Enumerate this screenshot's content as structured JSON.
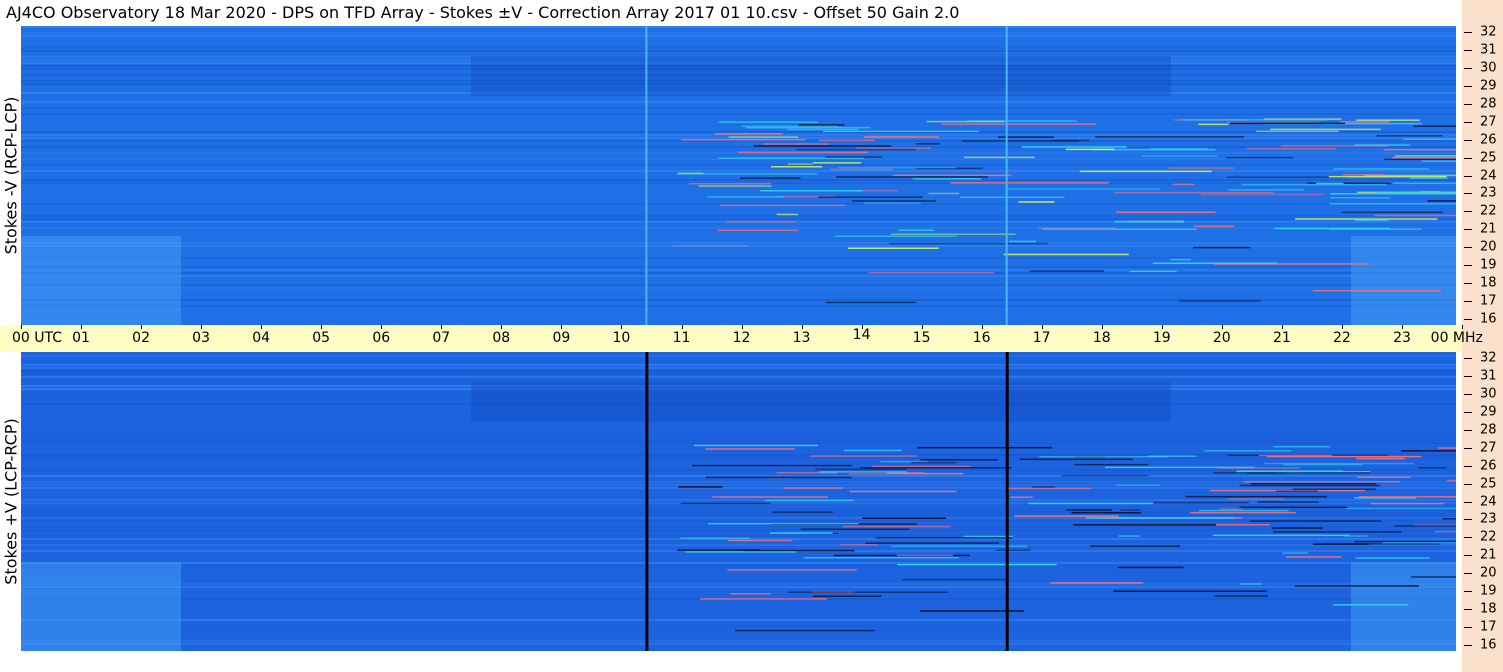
{
  "title": "AJ4CO Observatory  18 Mar 2020  -  DPS on TFD Array  -  Stokes ±V  -  Correction Array 2017 01 10.csv  -  Offset 50  Gain 2.0",
  "chart_data": [
    {
      "type": "heatmap",
      "name": "upper",
      "ylabel": "Stokes -V (RCP-LCP)",
      "ylim": [
        16,
        32
      ],
      "yticks": [
        "16",
        "17",
        "18",
        "19",
        "20",
        "21",
        "22",
        "23",
        "24",
        "25",
        "26",
        "27",
        "28",
        "29",
        "30",
        "31",
        "32"
      ],
      "base_color": "#1f6fe6",
      "vertical_lines_utc": [
        10.4,
        16.4
      ],
      "vertical_line_color": "#4ab8f0"
    },
    {
      "type": "heatmap",
      "name": "lower",
      "ylabel": "Stokes +V (LCP-RCP)",
      "ylim": [
        16,
        32
      ],
      "yticks": [
        "16",
        "17",
        "18",
        "19",
        "20",
        "21",
        "22",
        "23",
        "24",
        "25",
        "26",
        "27",
        "28",
        "29",
        "30",
        "31",
        "32"
      ],
      "base_color": "#1d63e0",
      "vertical_lines_utc": [
        10.4,
        16.4
      ],
      "vertical_line_color": "#000000"
    }
  ],
  "time_axis": {
    "labels": [
      "00",
      "01",
      "02",
      "03",
      "04",
      "05",
      "06",
      "07",
      "08",
      "09",
      "10",
      "11",
      "12",
      "13",
      "14",
      "15",
      "16",
      "17",
      "18",
      "19",
      "20",
      "21",
      "22",
      "23",
      "00"
    ],
    "first_suffix": "UTC",
    "last_suffix": "MHz"
  }
}
